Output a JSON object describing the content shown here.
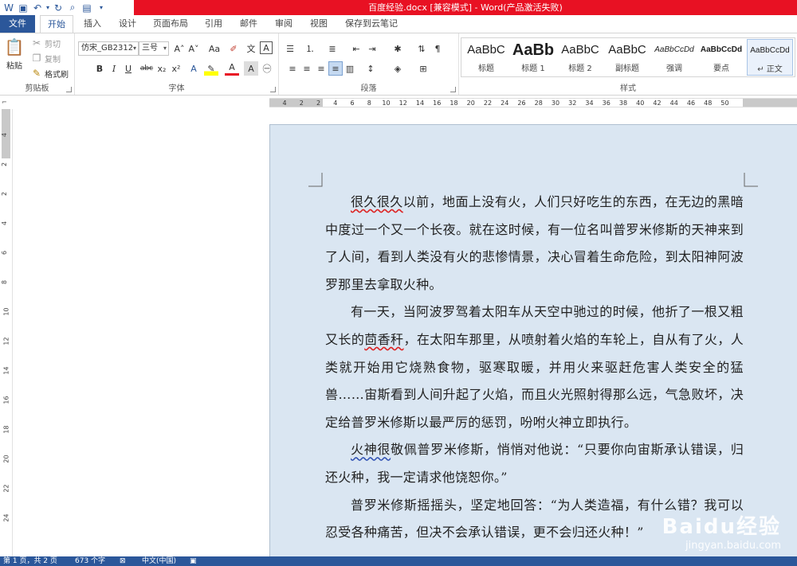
{
  "window": {
    "title": "百度经验.docx [兼容模式] - Word(产品激活失败)"
  },
  "quick_access": [
    "word-icon",
    "save-icon",
    "undo-icon",
    "redo-icon",
    "print-preview-icon",
    "open-icon",
    "more-icon"
  ],
  "tabs": [
    {
      "label": "文件"
    },
    {
      "label": "开始"
    },
    {
      "label": "插入"
    },
    {
      "label": "设计"
    },
    {
      "label": "页面布局"
    },
    {
      "label": "引用"
    },
    {
      "label": "邮件"
    },
    {
      "label": "审阅"
    },
    {
      "label": "视图"
    },
    {
      "label": "保存到云笔记"
    }
  ],
  "clipboard": {
    "paste": "粘贴",
    "cut": "剪切",
    "copy": "复制",
    "format_painter": "格式刷",
    "group_label": "剪贴板"
  },
  "font": {
    "family": "仿宋_GB2312",
    "size": "三号",
    "group_label": "字体",
    "bold": "B",
    "italic": "I",
    "underline": "U",
    "strike": "abc",
    "sub": "x₂",
    "sup": "x²",
    "grow": "A˄",
    "shrink": "A˅",
    "case": "Aa",
    "char_a": "A"
  },
  "paragraph": {
    "group_label": "段落"
  },
  "styles": {
    "group_label": "样式",
    "items": [
      {
        "preview": "AaBbC",
        "name": "标题"
      },
      {
        "preview": "AaBb",
        "name": "标题 1"
      },
      {
        "preview": "AaBbC",
        "name": "标题 2"
      },
      {
        "preview": "AaBbC",
        "name": "副标题"
      },
      {
        "preview": "AaBbCcDd",
        "name": "强调"
      },
      {
        "preview": "AaBbCcDd",
        "name": "要点"
      },
      {
        "preview": "AaBbCcDd",
        "name": "↵ 正文"
      }
    ]
  },
  "ruler": {
    "ticks": [
      "4",
      "2",
      "2",
      "4",
      "6",
      "8",
      "10",
      "12",
      "14",
      "16",
      "18",
      "20",
      "22",
      "24",
      "26",
      "28",
      "30",
      "32",
      "34",
      "36",
      "38",
      "40",
      "42",
      "44",
      "46",
      "48",
      "50"
    ],
    "vticks": [
      "4",
      "2",
      "2",
      "4",
      "6",
      "8",
      "10",
      "12",
      "14",
      "16",
      "18",
      "20",
      "22",
      "24"
    ]
  },
  "document": {
    "paragraphs": [
      {
        "pre_mark": "很久很久",
        "text": "以前，地面上没有火，人们只好吃生的东西，在无边的黑暗中度过一个又一个长夜。就在这时候，有一位名叫普罗米修斯的天神来到了人间，看到人类没有火的悲惨情景，决心冒着生命危险，到太阳神阿波罗那里去拿取火种。"
      },
      {
        "pre": "有一天，当阿波罗驾着太阳车从天空中驰过的时候，他折了一根又粗又长的",
        "mark": "茴香秆",
        "text": "，在太阳车那里，从喷射着火焰的车轮上，自从有了火，人类就开始用它烧熟食物，驱寒取暖，并用火来驱赶危害人类安全的猛兽……宙斯看到人间升起了火焰，而且火光照射得那么远，气急败坏，决定给普罗米修斯以最严厉的惩罚，吩咐火神立即执行。"
      },
      {
        "pre_mark_blue": "火神很",
        "text": "敬佩普罗米修斯，悄悄对他说：“只要你向宙斯承认错误，归还火种，我一定请求他饶恕你。”"
      },
      {
        "text": "普罗米修斯摇摇头，坚定地回答：“为人类造福，有什么错？我可以忍受各种痛苦，但决不会承认错误，更不会归还火种！”"
      }
    ]
  },
  "watermark": {
    "big": "Baidu经验",
    "small": "jingyan.baidu.com"
  },
  "status": {
    "page": "第 1 页，共 2 页",
    "words": "673 个字",
    "lang": "中文(中国)"
  }
}
